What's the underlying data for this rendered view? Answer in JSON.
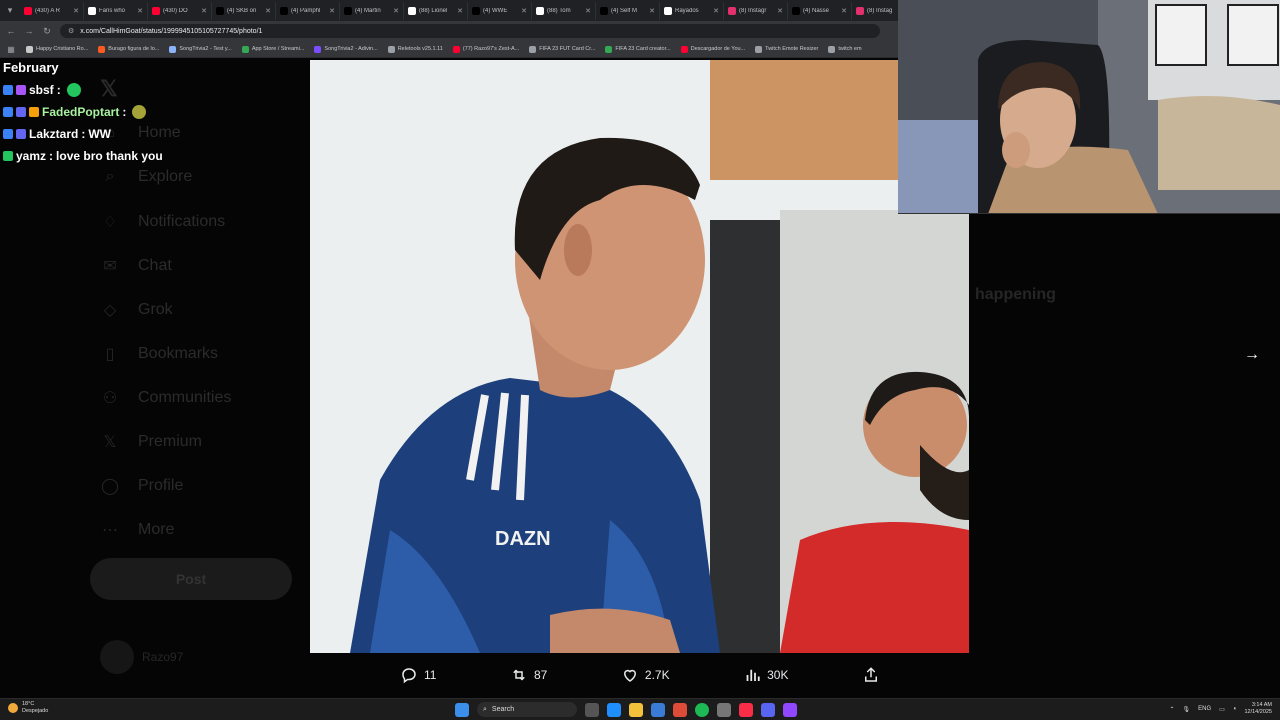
{
  "browser": {
    "tabs": [
      {
        "title": "(430) A R",
        "color": "#ff0033"
      },
      {
        "title": "Fans who",
        "color": "#ffffff"
      },
      {
        "title": "(430) DO",
        "color": "#ff0033"
      },
      {
        "title": "(4) SKB on",
        "color": "#000000"
      },
      {
        "title": "(4) Pamphl",
        "color": "#000000"
      },
      {
        "title": "(4) Martin",
        "color": "#000000"
      },
      {
        "title": "(88) Lionel",
        "color": "#ffffff"
      },
      {
        "title": "(4) WWE",
        "color": "#000000"
      },
      {
        "title": "(88) Tom",
        "color": "#ffffff"
      },
      {
        "title": "(4) Self M",
        "color": "#000000"
      },
      {
        "title": "Rayados",
        "color": "#ffffff"
      },
      {
        "title": "(8) Instagr",
        "color": "#e1306c"
      },
      {
        "title": "(4) Nasse",
        "color": "#000000"
      },
      {
        "title": "(8) Instag",
        "color": "#e1306c"
      }
    ],
    "url": "x.com/CallHimGoat/status/1999945105105727745/photo/1",
    "bookmarks": [
      {
        "label": "Happy Cristiano Ro...",
        "color": "#c9c9c9"
      },
      {
        "label": "Burago figura de lo...",
        "color": "#ff5a1f"
      },
      {
        "label": "SongTrivia2 - Test y...",
        "color": "#8ab4f8"
      },
      {
        "label": "App Store / Streami...",
        "color": "#34a853"
      },
      {
        "label": "SongTrivia2 - Adivin...",
        "color": "#7c4dff"
      },
      {
        "label": "Reletools v25.1.11",
        "color": "#9aa0a6"
      },
      {
        "label": "(77) Razo97's Zest-A...",
        "color": "#ff0033"
      },
      {
        "label": "FIFA 23 FUT Card Cr...",
        "color": "#9aa0a6"
      },
      {
        "label": "FIFA 23 Card creator...",
        "color": "#34a853"
      },
      {
        "label": "Descargador de You...",
        "color": "#ff0033"
      },
      {
        "label": "Twitch Emote Resizer",
        "color": "#9aa0a6"
      },
      {
        "label": "twitch em",
        "color": "#9aa0a6"
      }
    ]
  },
  "x_nav": {
    "items": [
      "Home",
      "Explore",
      "Notifications",
      "Chat",
      "Grok",
      "Bookmarks",
      "Communities",
      "Premium",
      "Profile",
      "More"
    ],
    "post_label": "Post",
    "user_name": "Razo97"
  },
  "background_text": {
    "happening": "happening"
  },
  "chat": {
    "month": "February",
    "messages": [
      {
        "user": "sbsf",
        "user_color": "#ffffff",
        "text": ""
      },
      {
        "user": "FadedPoptart",
        "user_color": "#a7f3a0",
        "text": ""
      },
      {
        "user": "Lakztard",
        "user_color": "#ffffff",
        "text": "WW"
      },
      {
        "user": "yamz",
        "user_color": "#ffffff",
        "text": "love bro thank you"
      }
    ]
  },
  "post_actions": {
    "replies": "11",
    "reposts": "87",
    "likes": "2.7K",
    "views": "30K"
  },
  "taskbar": {
    "temp": "18°C",
    "weather": "Despejado",
    "search": "Search",
    "lang": "ENG",
    "time": "3:14 AM",
    "date": "12/14/2025"
  }
}
